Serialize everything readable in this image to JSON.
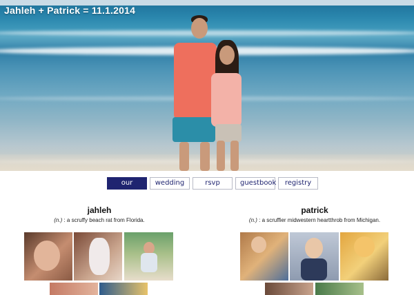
{
  "header": {
    "title": "Jahleh + Patrick = 11.1.2014"
  },
  "nav": {
    "items": [
      {
        "label": "our story",
        "active": true
      },
      {
        "label": "wedding",
        "active": false
      },
      {
        "label": "rsvp",
        "active": false
      },
      {
        "label": "guestbook",
        "active": false
      },
      {
        "label": "registry",
        "active": false
      }
    ]
  },
  "profiles": {
    "jahleh": {
      "name": "jahleh",
      "pos": "(n.)",
      "definition": " : a scruffy beach rat from Florida."
    },
    "patrick": {
      "name": "patrick",
      "pos": "(n.)",
      "definition": " : a scruffier midwestern heartthrob from Michigan."
    }
  },
  "colors": {
    "accent": "#1f2470",
    "nav_border": "#b8bac6"
  }
}
